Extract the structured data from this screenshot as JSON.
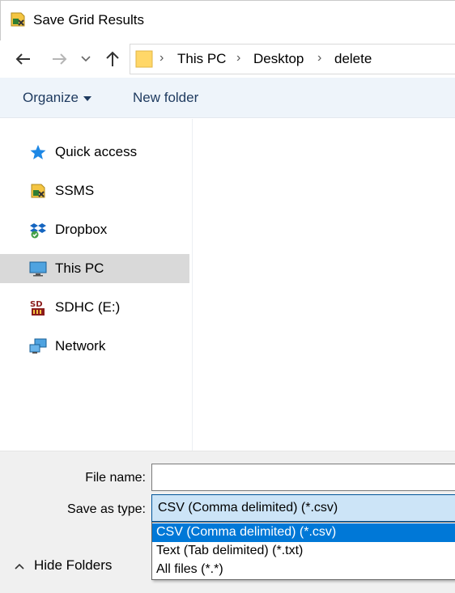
{
  "window": {
    "title": "Save Grid Results",
    "icon": "ssms-icon"
  },
  "navigation": {
    "back_icon": "arrow-left-icon",
    "forward_icon": "arrow-right-icon",
    "recent_icon": "chevron-down-icon",
    "up_icon": "arrow-up-icon",
    "breadcrumb": [
      "This PC",
      "Desktop",
      "delete"
    ]
  },
  "commands": {
    "organize_label": "Organize",
    "new_folder_label": "New folder"
  },
  "sidebar": {
    "items": [
      {
        "label": "Quick access",
        "icon": "star-icon"
      },
      {
        "label": "SSMS",
        "icon": "ssms-icon"
      },
      {
        "label": "Dropbox",
        "icon": "dropbox-icon"
      },
      {
        "label": "This PC",
        "icon": "monitor-icon",
        "selected": true
      },
      {
        "label": "SDHC (E:)",
        "icon": "sd-card-icon"
      },
      {
        "label": "Network",
        "icon": "network-icon"
      }
    ]
  },
  "form": {
    "file_name_label": "File name:",
    "file_name_value": "",
    "save_as_type_label": "Save as type:",
    "save_as_type_value": "CSV (Comma delimited) (*.csv)",
    "type_options": [
      "CSV (Comma delimited) (*.csv)",
      "Text (Tab delimited) (*.txt)",
      "All files (*.*)"
    ]
  },
  "footer": {
    "hide_folders_label": "Hide Folders"
  },
  "colors": {
    "accent": "#0078d7",
    "select_bg": "#cce4f7",
    "command_bar": "#eef4fa",
    "selected_item": "#d9d9d9"
  }
}
